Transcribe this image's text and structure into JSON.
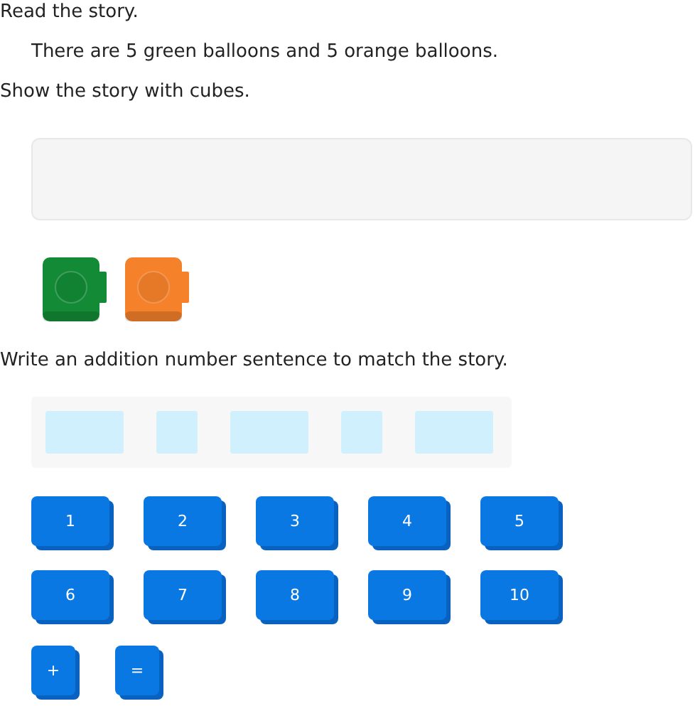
{
  "instructions": [
    {
      "text": "Read the story.",
      "indent": false
    },
    {
      "text": "There are 5 green balloons and 5 orange balloons.",
      "indent": true
    },
    {
      "text": "Show the story with cubes.",
      "indent": false
    }
  ],
  "cubes": [
    {
      "color": "#138a36"
    },
    {
      "color": "#f5812b"
    }
  ],
  "prompt": "Write an addition number sentence to match the story.",
  "answer_slots": [
    {
      "kind": "wide"
    },
    {
      "kind": "narrow"
    },
    {
      "kind": "wide"
    },
    {
      "kind": "narrow"
    },
    {
      "kind": "wide"
    }
  ],
  "number_tiles": [
    "1",
    "2",
    "3",
    "4",
    "5",
    "6",
    "7",
    "8",
    "9",
    "10"
  ],
  "operator_tiles": [
    "+",
    "="
  ]
}
